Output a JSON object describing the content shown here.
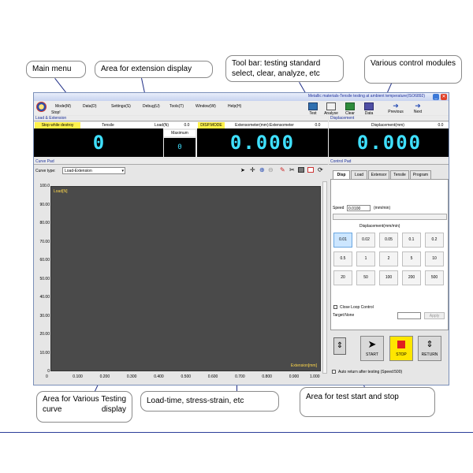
{
  "callouts": {
    "main_menu": "Main menu",
    "extension_display": "Area for extension display",
    "toolbar": "Tool bar: testing standard select, clear, analyze, etc",
    "control_modules": "Various control modules",
    "curve_display": "Area for Various Testing curve display",
    "load_time": "Load-time, stress-strain, etc",
    "start_stop": "Area for test start and stop"
  },
  "app": {
    "title": "Metallic materials-Tensile testing at ambient temperature(ISO6892)",
    "menu": [
      "Mode(M)",
      "Data(D)",
      "Settings(S)",
      "Debug(U)",
      "Tools(T)",
      "Window(W)",
      "Help(H)"
    ],
    "stop_label": "Stop!",
    "toolbar": [
      "Test",
      "Analyse",
      "Clear",
      "Data",
      "Previous",
      "Next"
    ]
  },
  "load_panel": {
    "title": "Load & Extension",
    "stop_while": "Stop while destroy",
    "tensile": "Tensile",
    "load_unit": "Load(N)",
    "load_zero": "0.0",
    "maximum": "Maximum",
    "load_value": "0",
    "max_value": "0",
    "disp_mode": "DISP.MODE",
    "ext_header": "Extensometer(mm):Extensometer",
    "ext_zero": "0.0",
    "ext_value": "0.000"
  },
  "displacement_panel": {
    "title": "Displacement",
    "header": "Displacement(mm)",
    "zero": "0.0",
    "value": "0.000"
  },
  "curve_pad": {
    "title": "Curve Pad",
    "curve_type_label": "Curve type:",
    "curve_type_value": "Load-Extension",
    "y_label": "Load[N]",
    "x_label": "Extension[mm]"
  },
  "control_pad": {
    "title": "Control Pad",
    "tabs": [
      "Disp",
      "Load",
      "Extensor",
      "Tensile",
      "Program"
    ],
    "speed_label": "Speed",
    "speed_value": "0.0100",
    "speed_unit": "(mm/min)",
    "disp_group": "Displacement(mm/min)",
    "disp_buttons": [
      "0.01",
      "0.02",
      "0.05",
      "0.1",
      "0.2",
      "0.5",
      "1",
      "2",
      "5",
      "10",
      "20",
      "50",
      "100",
      "200",
      "500"
    ],
    "close_loop": "Close Loop Control",
    "target": "Target:None",
    "apply": "Apply",
    "start": "START",
    "stop": "STOP",
    "return": "RETURN",
    "auto_return": "Auto return after testing (Speed:500)"
  },
  "chart_data": {
    "type": "line",
    "xlabel": "Extension[mm]",
    "ylabel": "Load[N]",
    "xlim": [
      0,
      1.0
    ],
    "ylim": [
      0,
      100
    ],
    "x_ticks": [
      "0",
      "0.100",
      "0.200",
      "0.300",
      "0.400",
      "0.500",
      "0.600",
      "0.700",
      "0.800",
      "0.900",
      "1.000"
    ],
    "y_ticks": [
      "0",
      "10.00",
      "20.00",
      "30.00",
      "40.00",
      "50.00",
      "60.00",
      "70.00",
      "80.00",
      "90.00",
      "100.0"
    ],
    "series": [],
    "grid": false
  },
  "colors": {
    "lcd_digits": "#3fe0ff",
    "stop_button": "#ffe600",
    "plot_bg": "#4a4a4a",
    "title_text": "#1c2e9c"
  }
}
